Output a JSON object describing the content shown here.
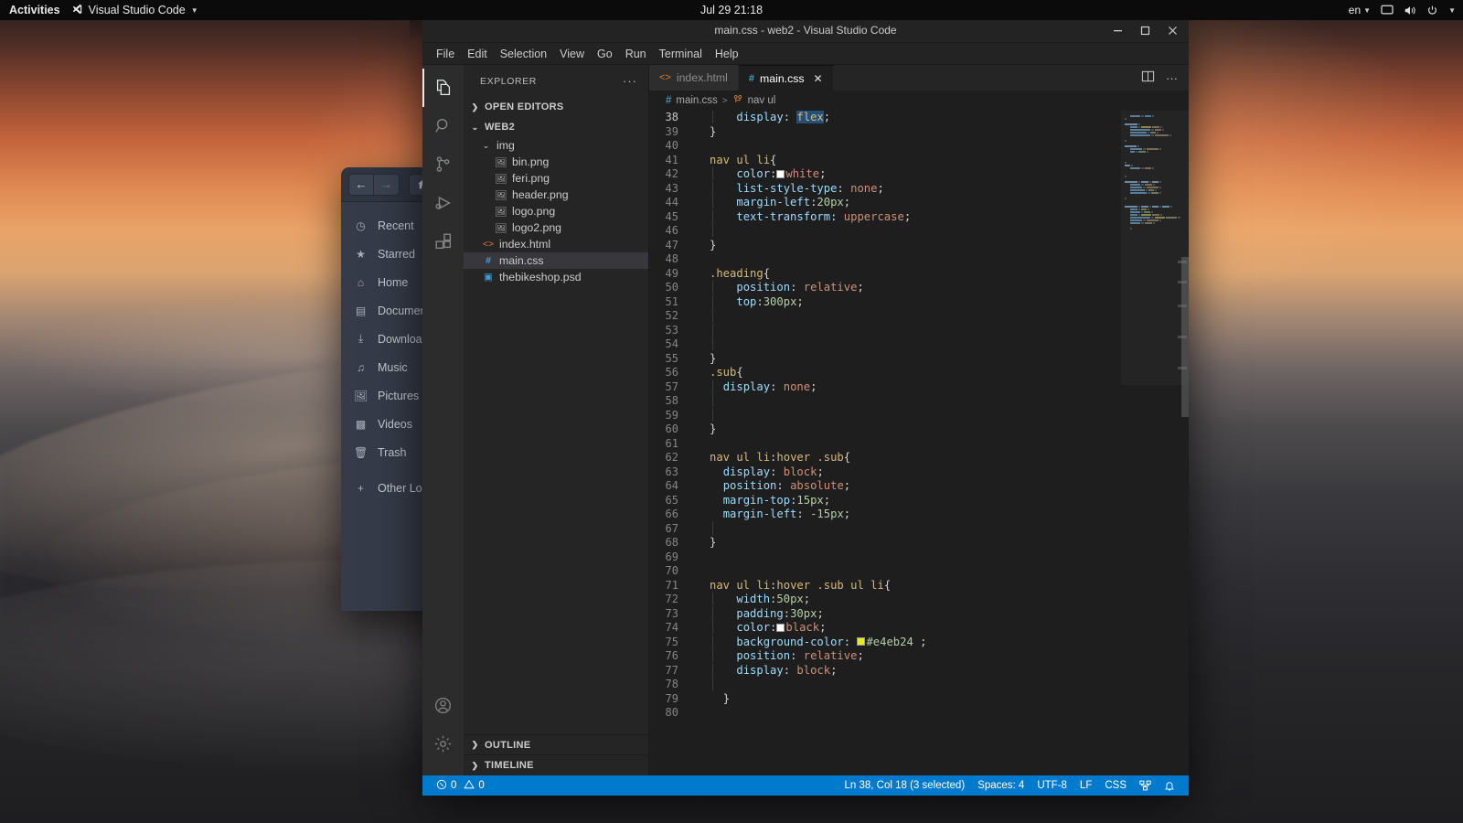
{
  "top_panel": {
    "activities": "Activities",
    "app_name": "Visual Studio Code",
    "app_icon": "vscode-icon",
    "clock": "Jul 29  21:18",
    "keyboard_layout": "en",
    "tray_icons": [
      "display-icon",
      "volume-icon",
      "power-icon"
    ]
  },
  "files_window": {
    "nav": {
      "back": "←",
      "forward": "→",
      "home": "⌂"
    },
    "sidebar_items": [
      {
        "label": "Recent",
        "icon": "clock-icon"
      },
      {
        "label": "Starred",
        "icon": "star-icon"
      },
      {
        "label": "Home",
        "icon": "home-icon"
      },
      {
        "label": "Documents",
        "icon": "document-icon"
      },
      {
        "label": "Downloads",
        "icon": "download-icon"
      },
      {
        "label": "Music",
        "icon": "music-icon"
      },
      {
        "label": "Pictures",
        "icon": "picture-icon"
      },
      {
        "label": "Videos",
        "icon": "video-icon"
      },
      {
        "label": "Trash",
        "icon": "trash-icon"
      },
      {
        "label": "Other Locations",
        "icon": "plus-icon"
      }
    ]
  },
  "vscode": {
    "title": "main.css - web2 - Visual Studio Code",
    "window_controls": {
      "minimize": "−",
      "maximize": "□",
      "close": "✕"
    },
    "menu": [
      "File",
      "Edit",
      "Selection",
      "View",
      "Go",
      "Run",
      "Terminal",
      "Help"
    ],
    "activity_bar": {
      "top": [
        "explorer-icon",
        "search-icon",
        "source-control-icon",
        "run-debug-icon",
        "extensions-icon"
      ],
      "bottom": [
        "account-icon",
        "settings-gear-icon"
      ]
    },
    "sidebar": {
      "header": "EXPLORER",
      "more_actions": "···",
      "open_editors_label": "OPEN EDITORS",
      "root_folder": "WEB2",
      "tree": [
        {
          "label": "img",
          "icon": "folder-open-icon",
          "depth": 1,
          "type": "folder",
          "selected": false
        },
        {
          "label": "bin.png",
          "icon": "image-file-icon",
          "depth": 2,
          "type": "file",
          "selected": false
        },
        {
          "label": "feri.png",
          "icon": "image-file-icon",
          "depth": 2,
          "type": "file",
          "selected": false
        },
        {
          "label": "header.png",
          "icon": "image-file-icon",
          "depth": 2,
          "type": "file",
          "selected": false
        },
        {
          "label": "logo.png",
          "icon": "image-file-icon",
          "depth": 2,
          "type": "file",
          "selected": false
        },
        {
          "label": "logo2.png",
          "icon": "image-file-icon",
          "depth": 2,
          "type": "file",
          "selected": false
        },
        {
          "label": "index.html",
          "icon": "html-file-icon",
          "depth": 1,
          "type": "file",
          "selected": false
        },
        {
          "label": "main.css",
          "icon": "css-file-icon",
          "depth": 1,
          "type": "file",
          "selected": true
        },
        {
          "label": "thebikeshop.psd",
          "icon": "psd-file-icon",
          "depth": 1,
          "type": "file",
          "selected": false
        }
      ],
      "outline_label": "OUTLINE",
      "timeline_label": "TIMELINE"
    },
    "tabs": [
      {
        "label": "index.html",
        "icon": "html-file-icon",
        "active": false,
        "closable": false
      },
      {
        "label": "main.css",
        "icon": "css-file-icon",
        "active": true,
        "closable": true
      }
    ],
    "tab_actions": [
      "split-editor-icon",
      "more-actions-icon"
    ],
    "breadcrumb": {
      "file_icon": "css-file-icon",
      "file": "main.css",
      "separator": ">",
      "symbol_icon": "css-selector-icon",
      "symbol": "nav ul"
    },
    "status_bar": {
      "errors_icon": "error-icon",
      "errors": "0",
      "warnings_icon": "warning-icon",
      "warnings": "0",
      "cursor": "Ln 38, Col 18 (3 selected)",
      "indentation": "Spaces: 4",
      "encoding": "UTF-8",
      "eol": "LF",
      "language": "CSS",
      "remote_icon": "remote-icon",
      "bell_icon": "bell-icon"
    },
    "editor": {
      "first_line_number": 38,
      "selection": {
        "line": 38,
        "text": "flex"
      },
      "lines": [
        {
          "n": 38,
          "indent": 1,
          "tokens": [
            {
              "t": "prop",
              "v": "display"
            },
            {
              "t": "punc",
              "v": ": "
            },
            {
              "t": "sel",
              "v": "flex",
              "hl": true
            },
            {
              "t": "punc",
              "v": ";"
            }
          ]
        },
        {
          "n": 39,
          "indent": 0,
          "tokens": [
            {
              "t": "brace",
              "v": "}"
            }
          ]
        },
        {
          "n": 40,
          "indent": 0,
          "tokens": []
        },
        {
          "n": 41,
          "indent": 0,
          "tokens": [
            {
              "t": "sel",
              "v": "nav ul li"
            },
            {
              "t": "brace",
              "v": "{"
            }
          ]
        },
        {
          "n": 42,
          "indent": 1,
          "tokens": [
            {
              "t": "prop",
              "v": "color"
            },
            {
              "t": "punc",
              "v": ":"
            },
            {
              "t": "swatch",
              "v": "#ffffff"
            },
            {
              "t": "val",
              "v": "white"
            },
            {
              "t": "punc",
              "v": ";"
            }
          ]
        },
        {
          "n": 43,
          "indent": 1,
          "tokens": [
            {
              "t": "prop",
              "v": "list-style-type"
            },
            {
              "t": "punc",
              "v": ": "
            },
            {
              "t": "val",
              "v": "none"
            },
            {
              "t": "punc",
              "v": ";"
            }
          ]
        },
        {
          "n": 44,
          "indent": 1,
          "tokens": [
            {
              "t": "prop",
              "v": "margin-left"
            },
            {
              "t": "punc",
              "v": ":"
            },
            {
              "t": "num",
              "v": "20px"
            },
            {
              "t": "punc",
              "v": ";"
            }
          ]
        },
        {
          "n": 45,
          "indent": 1,
          "tokens": [
            {
              "t": "prop",
              "v": "text-transform"
            },
            {
              "t": "punc",
              "v": ": "
            },
            {
              "t": "val",
              "v": "uppercase"
            },
            {
              "t": "punc",
              "v": ";"
            }
          ]
        },
        {
          "n": 46,
          "indent": 1,
          "tokens": []
        },
        {
          "n": 47,
          "indent": 0,
          "tokens": [
            {
              "t": "brace",
              "v": "}"
            }
          ]
        },
        {
          "n": 48,
          "indent": 0,
          "tokens": []
        },
        {
          "n": 49,
          "indent": 0,
          "tokens": [
            {
              "t": "class",
              "v": ".heading"
            },
            {
              "t": "brace",
              "v": "{"
            }
          ]
        },
        {
          "n": 50,
          "indent": 1,
          "tokens": [
            {
              "t": "prop",
              "v": "position"
            },
            {
              "t": "punc",
              "v": ": "
            },
            {
              "t": "val",
              "v": "relative"
            },
            {
              "t": "punc",
              "v": ";"
            }
          ]
        },
        {
          "n": 51,
          "indent": 1,
          "tokens": [
            {
              "t": "prop",
              "v": "top"
            },
            {
              "t": "punc",
              "v": ":"
            },
            {
              "t": "num",
              "v": "300px"
            },
            {
              "t": "punc",
              "v": ";"
            }
          ]
        },
        {
          "n": 52,
          "indent": 1,
          "tokens": []
        },
        {
          "n": 53,
          "indent": 1,
          "tokens": []
        },
        {
          "n": 54,
          "indent": 1,
          "tokens": []
        },
        {
          "n": 55,
          "indent": 0,
          "tokens": [
            {
              "t": "brace",
              "v": "}"
            }
          ]
        },
        {
          "n": 56,
          "indent": 0,
          "tokens": [
            {
              "t": "class",
              "v": ".sub"
            },
            {
              "t": "brace",
              "v": "{"
            }
          ]
        },
        {
          "n": 57,
          "indent": 1,
          "half": true,
          "tokens": [
            {
              "t": "prop",
              "v": "display"
            },
            {
              "t": "punc",
              "v": ": "
            },
            {
              "t": "val",
              "v": "none"
            },
            {
              "t": "punc",
              "v": ";"
            }
          ]
        },
        {
          "n": 58,
          "indent": 1,
          "tokens": []
        },
        {
          "n": 59,
          "indent": 1,
          "tokens": []
        },
        {
          "n": 60,
          "indent": 0,
          "tokens": [
            {
              "t": "brace",
              "v": "}"
            }
          ]
        },
        {
          "n": 61,
          "indent": 0,
          "tokens": []
        },
        {
          "n": 62,
          "indent": 0,
          "tokens": [
            {
              "t": "sel",
              "v": "nav ul li"
            },
            {
              "t": "plain",
              "v": ":"
            },
            {
              "t": "sel",
              "v": "hover"
            },
            {
              "t": "plain",
              "v": " "
            },
            {
              "t": "class",
              "v": ".sub"
            },
            {
              "t": "brace",
              "v": "{"
            }
          ]
        },
        {
          "n": 63,
          "indent": 0,
          "half": true,
          "tokens": [
            {
              "t": "prop",
              "v": "display"
            },
            {
              "t": "punc",
              "v": ": "
            },
            {
              "t": "val",
              "v": "block"
            },
            {
              "t": "punc",
              "v": ";"
            }
          ]
        },
        {
          "n": 64,
          "indent": 0,
          "half": true,
          "tokens": [
            {
              "t": "prop",
              "v": "position"
            },
            {
              "t": "punc",
              "v": ": "
            },
            {
              "t": "val",
              "v": "absolute"
            },
            {
              "t": "punc",
              "v": ";"
            }
          ]
        },
        {
          "n": 65,
          "indent": 0,
          "half": true,
          "tokens": [
            {
              "t": "prop",
              "v": "margin-top"
            },
            {
              "t": "punc",
              "v": ":"
            },
            {
              "t": "num",
              "v": "15px"
            },
            {
              "t": "punc",
              "v": ";"
            }
          ]
        },
        {
          "n": 66,
          "indent": 0,
          "half": true,
          "tokens": [
            {
              "t": "prop",
              "v": "margin-left"
            },
            {
              "t": "punc",
              "v": ": "
            },
            {
              "t": "num",
              "v": "-15px"
            },
            {
              "t": "punc",
              "v": ";"
            }
          ]
        },
        {
          "n": 67,
          "indent": 1,
          "tokens": []
        },
        {
          "n": 68,
          "indent": 0,
          "tokens": [
            {
              "t": "brace",
              "v": "}"
            }
          ]
        },
        {
          "n": 69,
          "indent": 0,
          "tokens": []
        },
        {
          "n": 70,
          "indent": 0,
          "tokens": []
        },
        {
          "n": 71,
          "indent": 0,
          "tokens": [
            {
              "t": "sel",
              "v": "nav ul li"
            },
            {
              "t": "plain",
              "v": ":"
            },
            {
              "t": "sel",
              "v": "hover"
            },
            {
              "t": "plain",
              "v": " "
            },
            {
              "t": "class",
              "v": ".sub"
            },
            {
              "t": "plain",
              "v": " "
            },
            {
              "t": "sel",
              "v": "ul li"
            },
            {
              "t": "brace",
              "v": "{"
            }
          ]
        },
        {
          "n": 72,
          "indent": 1,
          "tokens": [
            {
              "t": "prop",
              "v": "width"
            },
            {
              "t": "punc",
              "v": ":"
            },
            {
              "t": "num",
              "v": "50px"
            },
            {
              "t": "punc",
              "v": ";"
            }
          ]
        },
        {
          "n": 73,
          "indent": 1,
          "tokens": [
            {
              "t": "prop",
              "v": "padding"
            },
            {
              "t": "punc",
              "v": ":"
            },
            {
              "t": "num",
              "v": "30px"
            },
            {
              "t": "punc",
              "v": ";"
            }
          ]
        },
        {
          "n": 74,
          "indent": 1,
          "tokens": [
            {
              "t": "prop",
              "v": "color"
            },
            {
              "t": "punc",
              "v": ":"
            },
            {
              "t": "swatch",
              "v": "#ffffff"
            },
            {
              "t": "val",
              "v": "black"
            },
            {
              "t": "punc",
              "v": ";"
            }
          ]
        },
        {
          "n": 75,
          "indent": 1,
          "tokens": [
            {
              "t": "prop",
              "v": "background-color"
            },
            {
              "t": "punc",
              "v": ": "
            },
            {
              "t": "swatch",
              "v": "#e4eb24"
            },
            {
              "t": "num",
              "v": "#e4eb24"
            },
            {
              "t": "punc",
              "v": " ;"
            }
          ]
        },
        {
          "n": 76,
          "indent": 1,
          "tokens": [
            {
              "t": "prop",
              "v": "position"
            },
            {
              "t": "punc",
              "v": ": "
            },
            {
              "t": "val",
              "v": "relative"
            },
            {
              "t": "punc",
              "v": ";"
            }
          ]
        },
        {
          "n": 77,
          "indent": 1,
          "tokens": [
            {
              "t": "prop",
              "v": "display"
            },
            {
              "t": "punc",
              "v": ": "
            },
            {
              "t": "val",
              "v": "block"
            },
            {
              "t": "punc",
              "v": ";"
            }
          ]
        },
        {
          "n": 78,
          "indent": 1,
          "tokens": []
        },
        {
          "n": 79,
          "indent": 0,
          "half": true,
          "tokens": [
            {
              "t": "brace",
              "v": "}"
            }
          ]
        },
        {
          "n": 80,
          "indent": 0,
          "tokens": []
        }
      ]
    }
  }
}
